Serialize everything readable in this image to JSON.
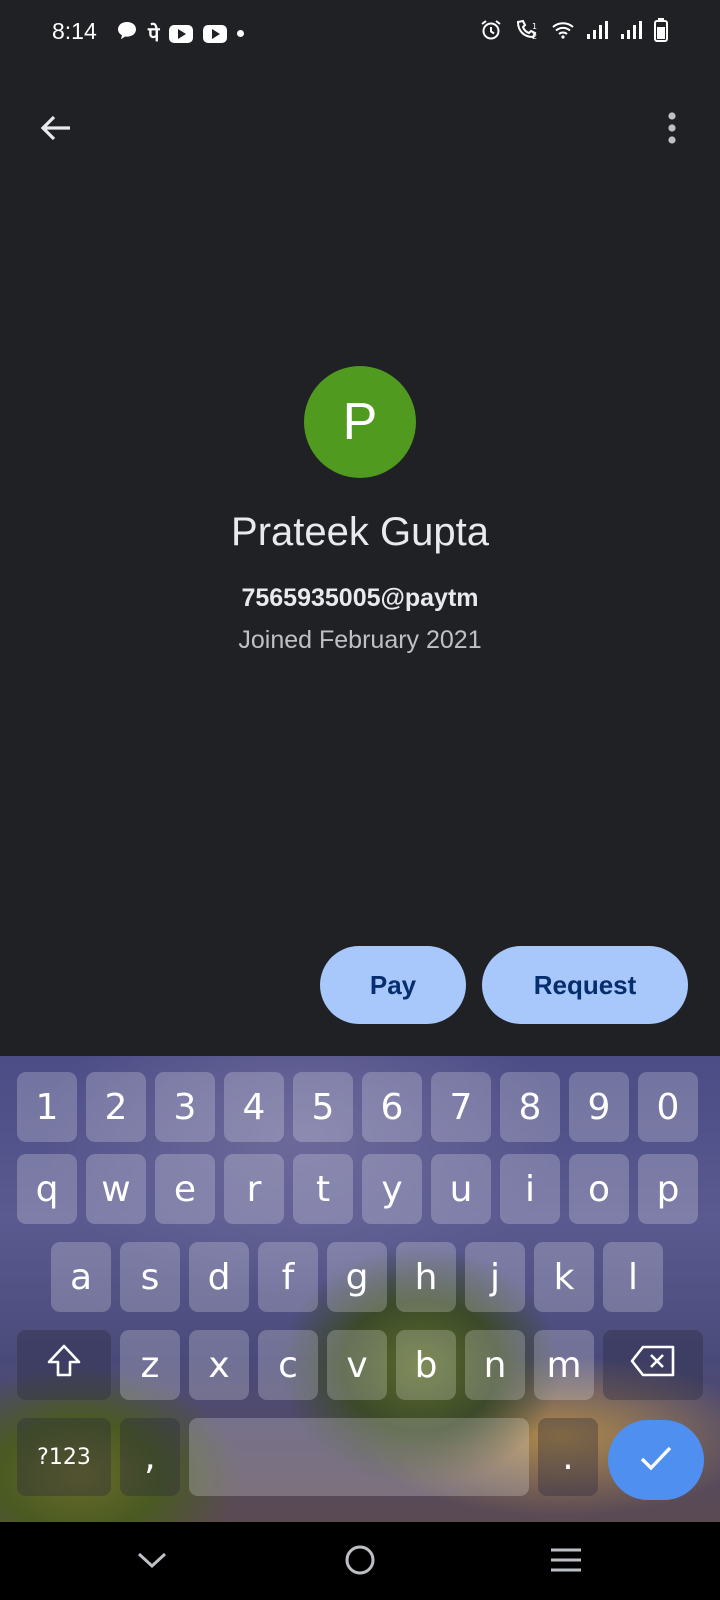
{
  "status_bar": {
    "time": "8:14",
    "left_icons": [
      "chat-bubble-icon",
      "phonepe-icon",
      "youtube-icon",
      "youtube-icon",
      "notification-dot-icon"
    ],
    "phonepe_glyph": "पे",
    "right_icons": [
      "alarm-icon",
      "wifi-calling-icon",
      "wifi-icon",
      "signal-icon",
      "signal-icon",
      "battery-icon"
    ]
  },
  "app_bar": {
    "back_icon": "arrow-back-icon",
    "more_icon": "more-vert-icon"
  },
  "profile": {
    "avatar_letter": "P",
    "avatar_color": "#4f9a1f",
    "name": "Prateek Gupta",
    "upi_id": "7565935005@paytm",
    "joined": "Joined February 2021"
  },
  "actions": {
    "pay_label": "Pay",
    "request_label": "Request",
    "button_color": "#a8c7fa"
  },
  "keyboard": {
    "row_numbers": [
      "1",
      "2",
      "3",
      "4",
      "5",
      "6",
      "7",
      "8",
      "9",
      "0"
    ],
    "row_1": [
      "q",
      "w",
      "e",
      "r",
      "t",
      "y",
      "u",
      "i",
      "o",
      "p"
    ],
    "row_2": [
      "a",
      "s",
      "d",
      "f",
      "g",
      "h",
      "j",
      "k",
      "l"
    ],
    "row_3": [
      "z",
      "x",
      "c",
      "v",
      "b",
      "n",
      "m"
    ],
    "symbols_label": "?123",
    "comma_label": ",",
    "period_label": ".",
    "shift_icon": "shift-icon",
    "backspace_icon": "backspace-icon",
    "enter_icon": "check-icon",
    "enter_color": "#4f8ff0"
  },
  "nav_bar": {
    "icons": [
      "nav-back-chevron-icon",
      "home-icon",
      "recents-icon"
    ]
  }
}
